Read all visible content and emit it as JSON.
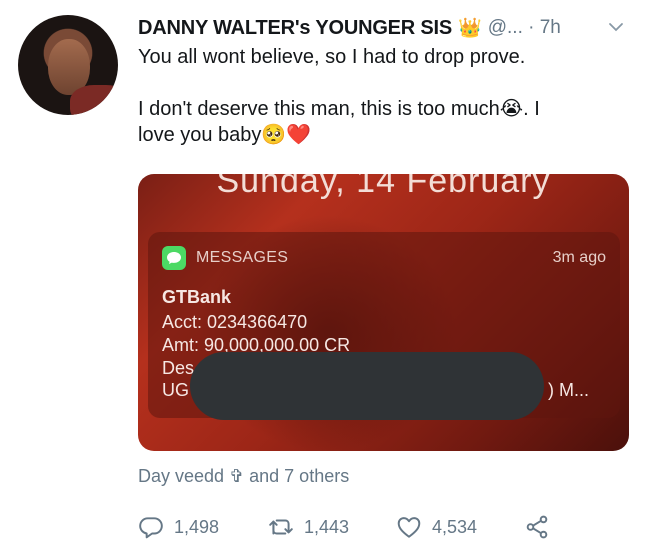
{
  "tweet": {
    "author_name": "DANNY WALTER's YOUNGER SIS",
    "badge_emoji": "👑",
    "handle": "@... · 7h",
    "text_line1": "You all wont believe, so I had to drop prove.",
    "text_line2": "I don't deserve this man, this is too much😭. I",
    "text_line3": "love you baby🥺❤️"
  },
  "media": {
    "date_text": "Sunday, 14 February",
    "notification": {
      "app_name": "MESSAGES",
      "time_ago": "3m ago",
      "sender": "GTBank",
      "acct": "Acct: 0234366470",
      "amt": "Amt: 90,000,000.00 CR",
      "desc_fragment": "Des",
      "ug_fragment": "UG",
      "tail_fragment": ") M..."
    }
  },
  "likers_text": "Day veedd ✞ and 7 others",
  "actions": {
    "reply_count": "1,498",
    "retweet_count": "1,443",
    "like_count": "4,534"
  }
}
